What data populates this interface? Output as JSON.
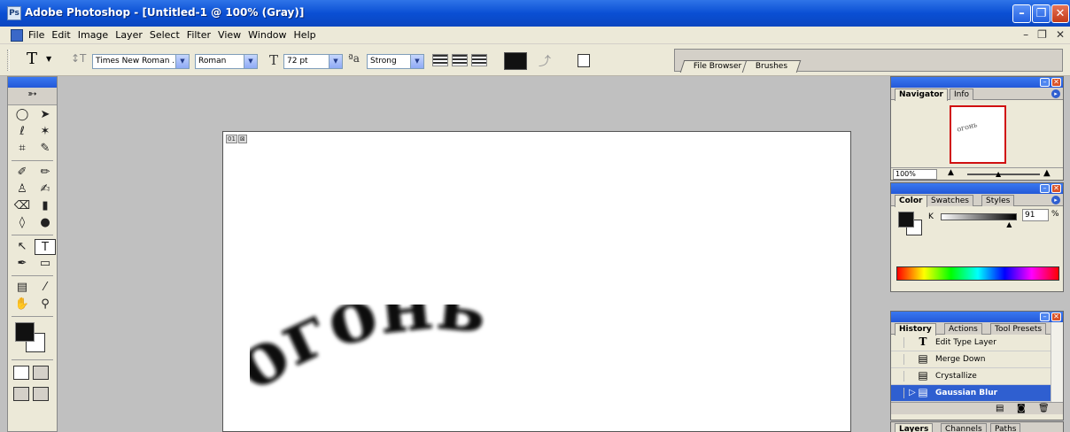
{
  "window": {
    "title": "Adobe Photoshop - [Untitled-1 @ 100% (Gray)]",
    "app_icon": "photoshop-icon",
    "buttons": [
      "minimize",
      "maximize",
      "close"
    ]
  },
  "menu": {
    "items": [
      "File",
      "Edit",
      "Image",
      "Layer",
      "Select",
      "Filter",
      "View",
      "Window",
      "Help"
    ]
  },
  "options_bar": {
    "tool_label": "T",
    "font_family": "Times New Roman ...",
    "font_style": "Roman",
    "font_size": "72 pt",
    "antialias": "Strong",
    "text_color": "#111111",
    "palette_well_tabs": [
      "File Browser",
      "Brushes"
    ]
  },
  "document": {
    "corner_labels": [
      "01",
      "⊠"
    ],
    "artwork_text": "огонь"
  },
  "navigator": {
    "tabs": [
      "Navigator",
      "Info"
    ],
    "zoom_value": "100%",
    "thumb_text": "огонь"
  },
  "color_palette": {
    "tabs": [
      "Color",
      "Swatches",
      "Styles"
    ],
    "channel_label": "K",
    "k_value": "91",
    "percent_sign": "%",
    "k_level": 0.91
  },
  "history": {
    "tabs": [
      "History",
      "Actions",
      "Tool Presets"
    ],
    "items": [
      {
        "label": "Edit Type Layer",
        "icon": "type-icon",
        "selected": false
      },
      {
        "label": "Merge Down",
        "icon": "history-state-icon",
        "selected": false
      },
      {
        "label": "Crystallize",
        "icon": "history-state-icon",
        "selected": false
      },
      {
        "label": "Gaussian Blur",
        "icon": "history-state-icon",
        "selected": true
      }
    ]
  },
  "layers": {
    "tabs": [
      "Layers",
      "Channels",
      "Paths"
    ]
  }
}
